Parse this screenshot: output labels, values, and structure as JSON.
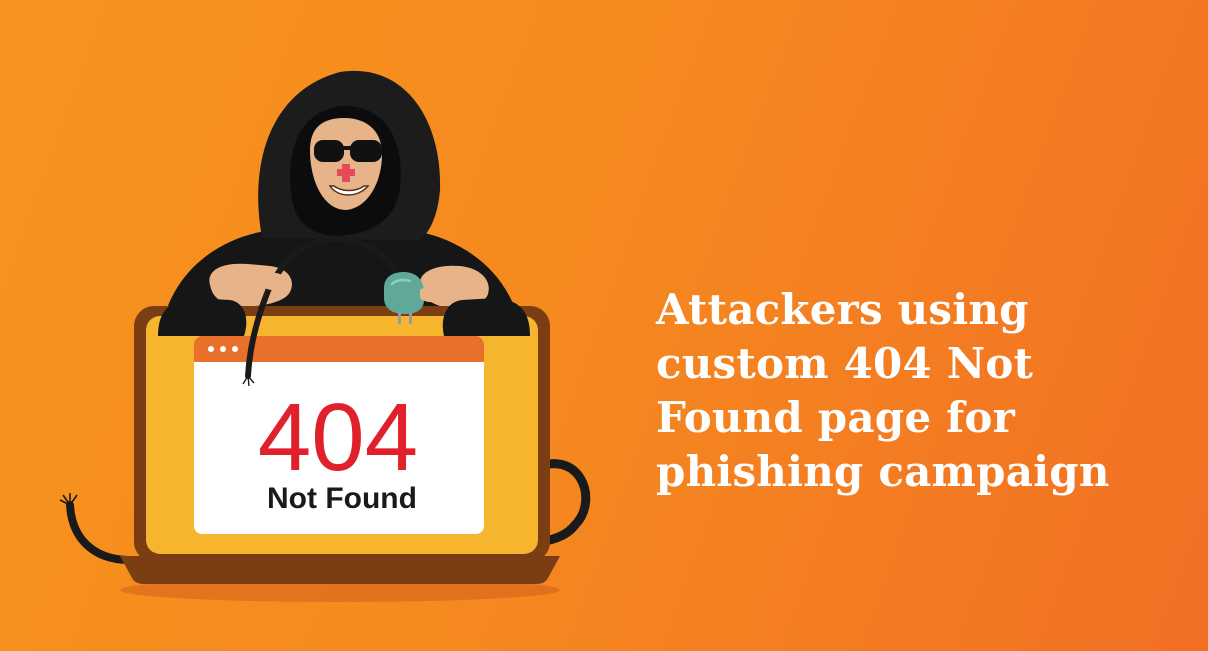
{
  "headline": {
    "lines": [
      "Attackers using",
      "custom 404 Not",
      "Found page for",
      "phishing campaign"
    ]
  },
  "error_screen": {
    "code": "404",
    "message": "Not Found"
  },
  "colors": {
    "background_start": "#f7931e",
    "background_end": "#f26f24",
    "laptop_frame": "#f5b52e",
    "laptop_border": "#7a3e12",
    "browser_bar": "#e8702a",
    "error_code": "#e0202a",
    "hoodie": "#161616",
    "headline_text": "#ffffff"
  },
  "icons": [
    "hacker-figure-icon",
    "sunglasses-icon",
    "power-plug-icon",
    "laptop-icon",
    "cable-icon"
  ]
}
